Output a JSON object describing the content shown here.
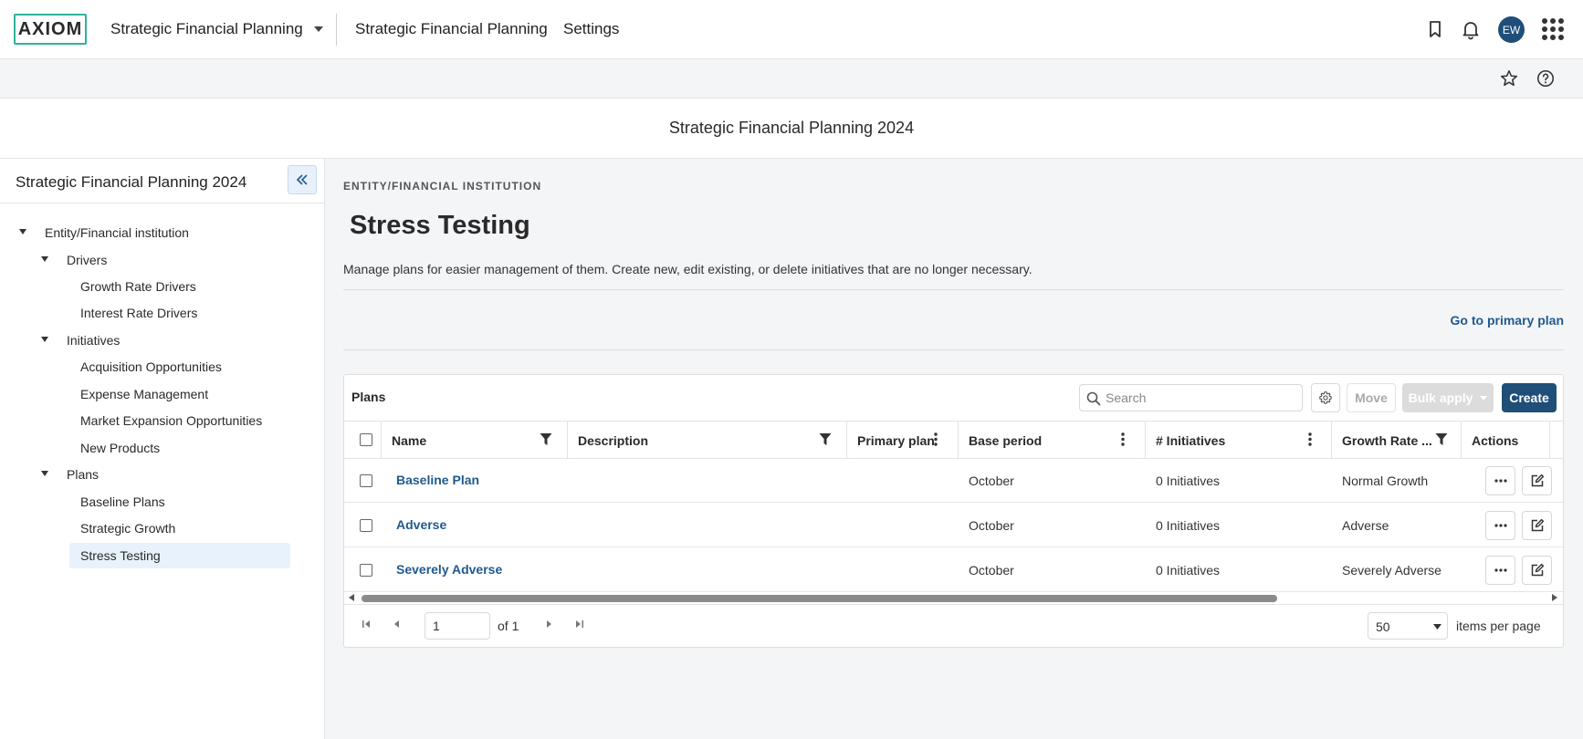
{
  "header": {
    "logo_text": "AXIOM",
    "app_switcher_label": "Strategic Financial Planning",
    "nav_links": [
      "Strategic Financial Planning",
      "Settings"
    ],
    "avatar_initials": "EW"
  },
  "page_title": "Strategic Financial Planning 2024",
  "sidebar": {
    "title": "Strategic Financial Planning 2024",
    "tree": {
      "root": "Entity/Financial institution",
      "groups": [
        {
          "label": "Drivers",
          "children": [
            "Growth Rate Drivers",
            "Interest Rate Drivers"
          ]
        },
        {
          "label": "Initiatives",
          "children": [
            "Acquisition Opportunities",
            "Expense Management",
            "Market Expansion Opportunities",
            "New Products"
          ]
        },
        {
          "label": "Plans",
          "children": [
            "Baseline Plans",
            "Strategic Growth",
            "Stress Testing"
          ]
        }
      ],
      "selected": "Stress Testing"
    }
  },
  "main": {
    "breadcrumb": "ENTITY/FINANCIAL INSTITUTION",
    "heading": "Stress Testing",
    "description": "Manage plans for easier management of them. Create new, edit existing, or delete initiatives that are no longer necessary.",
    "primary_link": "Go to primary plan"
  },
  "grid": {
    "title": "Plans",
    "search_placeholder": "Search",
    "buttons": {
      "move": "Move",
      "bulk_apply": "Bulk apply",
      "create": "Create"
    },
    "columns": [
      "Name",
      "Description",
      "Primary plan",
      "Base period",
      "# Initiatives",
      "Growth Rate ...",
      "Actions"
    ],
    "rows": [
      {
        "name": "Baseline Plan",
        "description": "",
        "primary_plan": "",
        "base_period": "October",
        "initiatives": "0 Initiatives",
        "growth_rate": "Normal Growth"
      },
      {
        "name": "Adverse",
        "description": "",
        "primary_plan": "",
        "base_period": "October",
        "initiatives": "0 Initiatives",
        "growth_rate": "Adverse"
      },
      {
        "name": "Severely Adverse",
        "description": "",
        "primary_plan": "",
        "base_period": "October",
        "initiatives": "0 Initiatives",
        "growth_rate": "Severely Adverse"
      }
    ],
    "pager": {
      "page": "1",
      "of_label": "of 1",
      "per_page": "50",
      "per_page_label": "items per page"
    }
  },
  "colors": {
    "brand": "#1f4e79",
    "link": "#1f5a8f",
    "logo_border": "#2fb39a",
    "selected_bg": "#e8f2fc"
  },
  "icons": [
    "chevron-down-icon",
    "bookmark-icon",
    "bell-icon",
    "apps-grid-icon",
    "star-icon",
    "help-icon",
    "double-chevron-left-icon",
    "search-icon",
    "gear-icon",
    "filter-icon",
    "kebab-icon",
    "ellipsis-icon",
    "edit-icon",
    "first-page-icon",
    "prev-page-icon",
    "next-page-icon",
    "last-page-icon"
  ]
}
